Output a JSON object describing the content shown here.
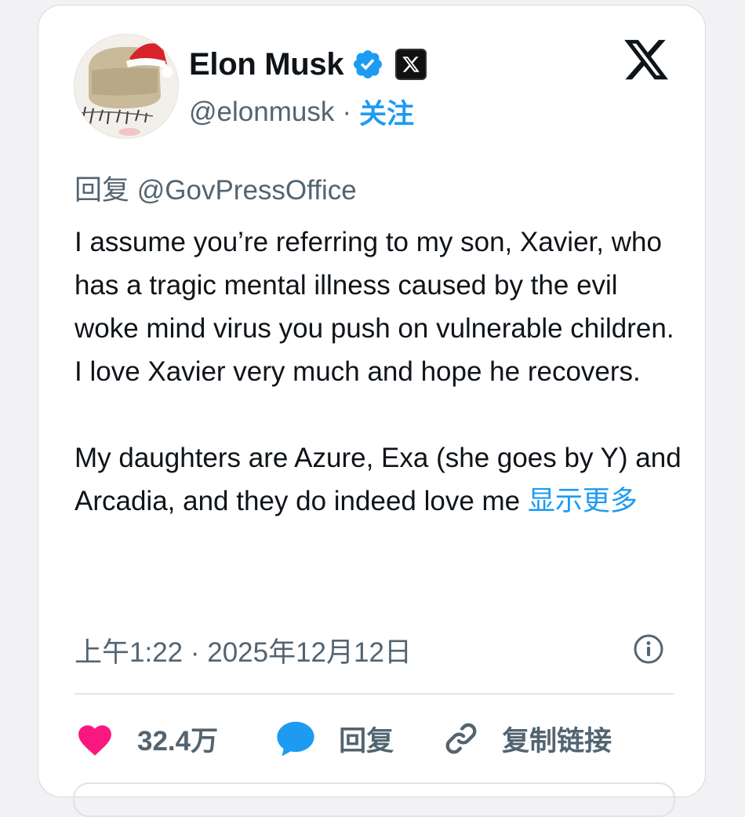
{
  "author": {
    "display_name": "Elon Musk",
    "handle": "@elonmusk",
    "separator": "·",
    "follow_label": "关注",
    "avatar_icon": "santa-hat-avatar",
    "verified_icon": "verified-badge-icon",
    "affiliation_icon": "x-affiliation-badge-icon"
  },
  "header": {
    "platform_logo": "x-logo-icon"
  },
  "tweet": {
    "reply_to": "回复 @GovPressOffice",
    "paragraphs": [
      "I assume you’re referring to my son, Xavier, who has a tragic mental illness caused by the evil woke mind virus you push on vulnerable children. I love Xavier very much and hope he recovers.",
      "My daughters are Azure, Exa (she goes by Y) and Arcadia, and they do indeed love me"
    ],
    "show_more_label": "显示更多",
    "timestamp": "上午1:22 · 2025年12月12日"
  },
  "actions": {
    "like_count": "32.4万",
    "reply_label": "回复",
    "copy_link_label": "复制链接"
  },
  "colors": {
    "accent": "#1d9bf0",
    "like": "#f91880",
    "text": "#0f1419",
    "muted": "#536471"
  }
}
